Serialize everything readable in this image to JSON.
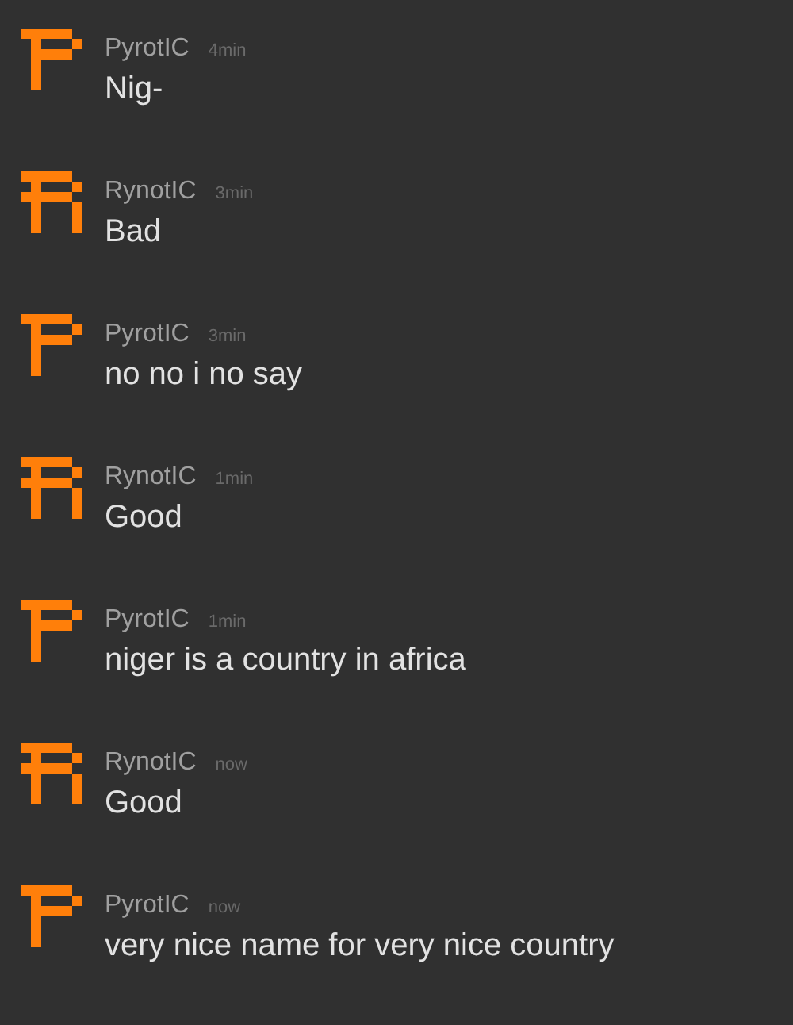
{
  "messages": [
    {
      "author": "PyrotIC",
      "time": "4min",
      "text": "Nig-",
      "kind": "p"
    },
    {
      "author": "RynotIC",
      "time": "3min",
      "text": "Bad",
      "kind": "r"
    },
    {
      "author": "PyrotIC",
      "time": "3min",
      "text": "no no i no say",
      "kind": "p"
    },
    {
      "author": "RynotIC",
      "time": "1min",
      "text": "Good",
      "kind": "r"
    },
    {
      "author": "PyrotIC",
      "time": "1min",
      "text": "niger is a country in africa",
      "kind": "p"
    },
    {
      "author": "RynotIC",
      "time": "now",
      "text": "Good",
      "kind": "r"
    },
    {
      "author": "PyrotIC",
      "time": "now",
      "text": "very nice name for very nice country",
      "kind": "p"
    }
  ]
}
